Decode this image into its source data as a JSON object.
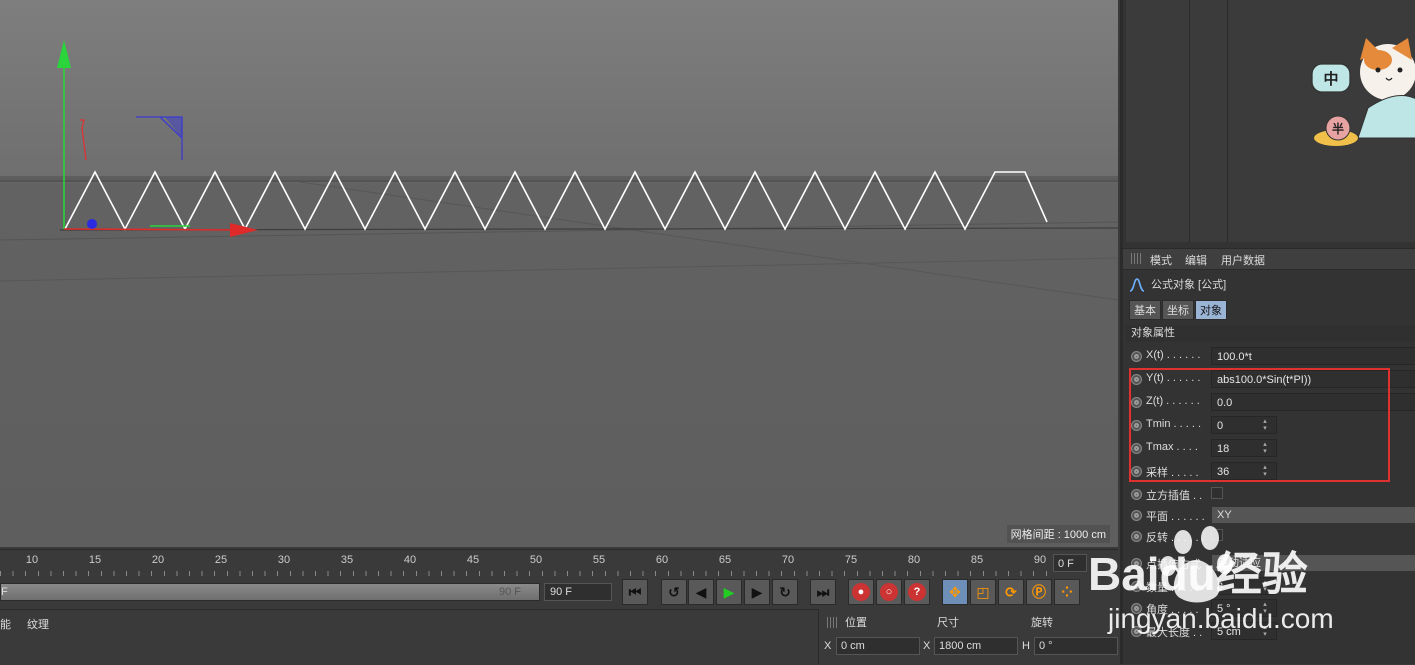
{
  "viewport": {
    "grid_spacing": "网格间距 : 1000 cm"
  },
  "attributes": {
    "menu": [
      "模式",
      "编辑",
      "用户数据"
    ],
    "object_title": "公式对象 [公式]",
    "tabs": [
      {
        "label": "基本",
        "active": false
      },
      {
        "label": "坐标",
        "active": false
      },
      {
        "label": "对象",
        "active": true
      }
    ],
    "section_title": "对象属性",
    "params": [
      {
        "label": "X(t) . . . . . .",
        "value": "100.0*t"
      },
      {
        "label": "Y(t) . . . . . .",
        "value": "abs100.0*Sin(t*PI))"
      },
      {
        "label": "Z(t) . . . . . .",
        "value": "0.0"
      },
      {
        "label": "Tmin . . . . .",
        "value": "0"
      },
      {
        "label": "Tmax . . . .",
        "value": "18"
      },
      {
        "label": "采样 . . . . .",
        "value": "36"
      },
      {
        "label": "立方插值 . .",
        "value": ""
      },
      {
        "label": "平面 . . . . . .",
        "value": "XY"
      },
      {
        "label": "反转 . . . . . .",
        "value": ""
      },
      {
        "label": "点插值方式",
        "value": "自动适应"
      },
      {
        "label": "数量 . . . . .",
        "value": "8"
      },
      {
        "label": "角度 . . . . .",
        "value": "5 °"
      },
      {
        "label": "最大长度 . .",
        "value": "5 cm"
      }
    ]
  },
  "timeline": {
    "ticks": [
      "10",
      "15",
      "20",
      "25",
      "30",
      "35",
      "40",
      "45",
      "50",
      "55",
      "60",
      "65",
      "70",
      "75",
      "80",
      "85",
      "90"
    ],
    "current_frame": "0 F",
    "range_start": "F",
    "range_end_inner": "90 F",
    "end_frame": "90 F"
  },
  "transport_icons": [
    "go-start-icon",
    "prev-key-icon",
    "prev-frame-icon",
    "play-icon",
    "next-frame-icon",
    "next-key-icon",
    "go-end-icon",
    "record-icon",
    "autokey-icon",
    "keyframe-help-icon",
    "move-icon",
    "scale-icon",
    "rotate-icon",
    "param-icon",
    "dots-icon"
  ],
  "bottom": {
    "menu": [
      "能",
      "纹理"
    ],
    "headers": [
      "位置",
      "尺寸",
      "旋转"
    ],
    "row": {
      "x_axis": "X",
      "x_pos": "0 cm",
      "x2_axis": "X",
      "size": "1800 cm",
      "h_axis": "H",
      "rot": "0 °"
    }
  },
  "watermark": {
    "brand": "Baidu经验",
    "url": "jingyan.baidu.com"
  },
  "colors": {
    "accent_red_box": "#e03030",
    "tab_active": "#9ab4d6",
    "axis_x": "#e02a2a",
    "axis_y": "#2ad43a",
    "axis_z": "#2a2ae0"
  }
}
